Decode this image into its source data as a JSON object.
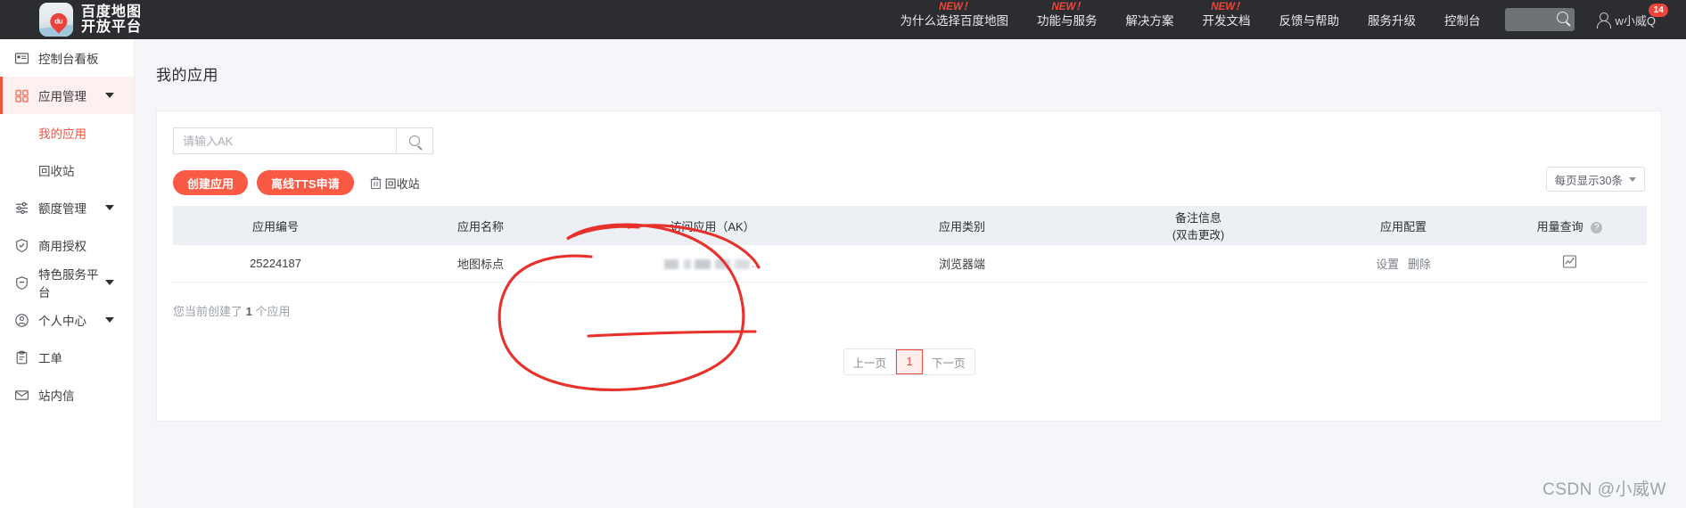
{
  "header": {
    "logo_line1": "百度地图",
    "logo_line2": "开放平台",
    "logo_pin_text": "du",
    "nav": [
      {
        "label": "为什么选择百度地图",
        "new_flag": "NEW！"
      },
      {
        "label": "功能与服务",
        "new_flag": "NEW！"
      },
      {
        "label": "解决方案",
        "new_flag": ""
      },
      {
        "label": "开发文档",
        "new_flag": "NEW！"
      },
      {
        "label": "反馈与帮助",
        "new_flag": ""
      },
      {
        "label": "服务升级",
        "new_flag": ""
      },
      {
        "label": "控制台",
        "new_flag": ""
      }
    ],
    "search_icon": "search-icon",
    "user_name": "w小威Q",
    "message_badge": "14"
  },
  "sidebar": {
    "items": [
      {
        "label": "控制台看板",
        "icon": "dashboard-icon",
        "active": false,
        "expandable": false
      },
      {
        "label": "应用管理",
        "icon": "grid-icon",
        "active": true,
        "expandable": true
      },
      {
        "label": "额度管理",
        "icon": "sliders-icon",
        "active": false,
        "expandable": true
      },
      {
        "label": "商用授权",
        "icon": "shield-check-icon",
        "active": false,
        "expandable": false
      },
      {
        "label": "特色服务平台",
        "icon": "shield-minus-icon",
        "active": false,
        "expandable": true
      },
      {
        "label": "个人中心",
        "icon": "user-circle-icon",
        "active": false,
        "expandable": true
      },
      {
        "label": "工单",
        "icon": "clipboard-icon",
        "active": false,
        "expandable": false
      },
      {
        "label": "站内信",
        "icon": "envelope-icon",
        "active": false,
        "expandable": false
      }
    ],
    "sub_items": [
      {
        "label": "我的应用",
        "current": true
      },
      {
        "label": "回收站",
        "current": false
      }
    ]
  },
  "main": {
    "page_title": "我的应用",
    "search": {
      "placeholder": "请输入AK",
      "value": "",
      "button_icon": "search-icon"
    },
    "actions": {
      "create_app": "创建应用",
      "offline_tts": "离线TTS申请",
      "recycle_bin": "回收站",
      "recycle_icon": "trash-icon"
    },
    "per_page": {
      "label": "每页显示30条",
      "caret_icon": "chevron-down-icon"
    },
    "table": {
      "columns": [
        {
          "label": "应用编号",
          "sub": ""
        },
        {
          "label": "应用名称",
          "sub": ""
        },
        {
          "label": "访问应用（AK）",
          "sub": ""
        },
        {
          "label": "应用类别",
          "sub": ""
        },
        {
          "label": "备注信息",
          "sub": "(双击更改)"
        },
        {
          "label": "应用配置",
          "sub": ""
        },
        {
          "label": "用量查询",
          "sub": "",
          "help_icon": "question-icon"
        }
      ],
      "rows": [
        {
          "app_id": "25224187",
          "app_name": "地图标点",
          "ak": "",
          "ak_masked": true,
          "ak_ellipsis": "...",
          "app_type": "浏览器端",
          "remark": "",
          "config_links": [
            "设置",
            "删除"
          ],
          "usage_icon": "chart-icon"
        }
      ]
    },
    "count_prefix": "您当前创建了",
    "count_value": "1",
    "count_suffix": "个应用",
    "pagination": {
      "prev": "上一页",
      "pages": [
        "1"
      ],
      "current_page": "1",
      "next": "下一页"
    }
  },
  "annotation": {
    "type": "hand-drawn-circle",
    "color": "#e8312a",
    "target": "访问应用（AK）column"
  },
  "watermark": "CSDN @小威W",
  "colors": {
    "accent": "#fa5943",
    "header_bg": "#2b2d31",
    "page_bg": "#f4f6f9",
    "table_header_bg": "#eceff4",
    "annotation_red": "#e8312a"
  }
}
